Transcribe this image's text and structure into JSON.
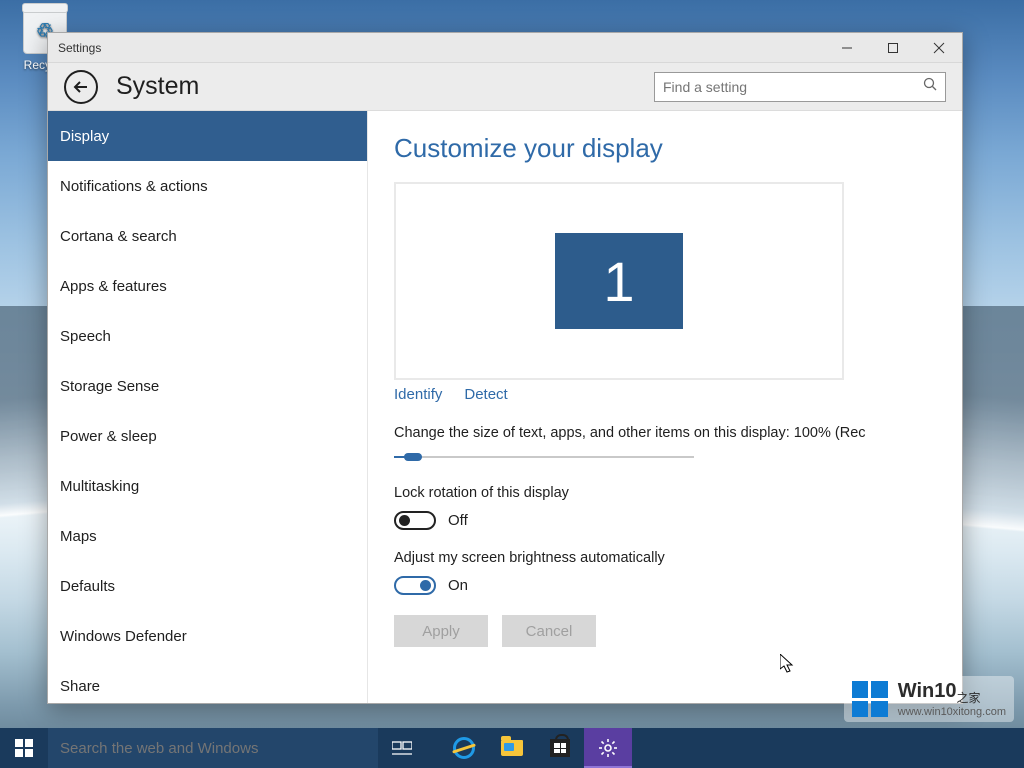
{
  "desktop": {
    "recycle_label": "Recycle"
  },
  "window": {
    "title": "Settings",
    "header_title": "System",
    "search_placeholder": "Find a setting"
  },
  "sidebar": {
    "items": [
      "Display",
      "Notifications & actions",
      "Cortana & search",
      "Apps & features",
      "Speech",
      "Storage Sense",
      "Power & sleep",
      "Multitasking",
      "Maps",
      "Defaults",
      "Windows Defender",
      "Share"
    ],
    "active_index": 0
  },
  "content": {
    "page_title": "Customize your display",
    "monitor_number": "1",
    "identify_label": "Identify",
    "detect_label": "Detect",
    "scale_label": "Change the size of text, apps, and other items on this display: 100% (Rec",
    "lock_rotation_label": "Lock rotation of this display",
    "lock_rotation_state": "Off",
    "brightness_label": "Adjust my screen brightness automatically",
    "brightness_state": "On",
    "apply_label": "Apply",
    "cancel_label": "Cancel"
  },
  "taskbar": {
    "search_placeholder": "Search the web and Windows"
  },
  "watermark": {
    "title": "Win10",
    "suffix": "之家",
    "url": "www.win10xitong.com"
  }
}
